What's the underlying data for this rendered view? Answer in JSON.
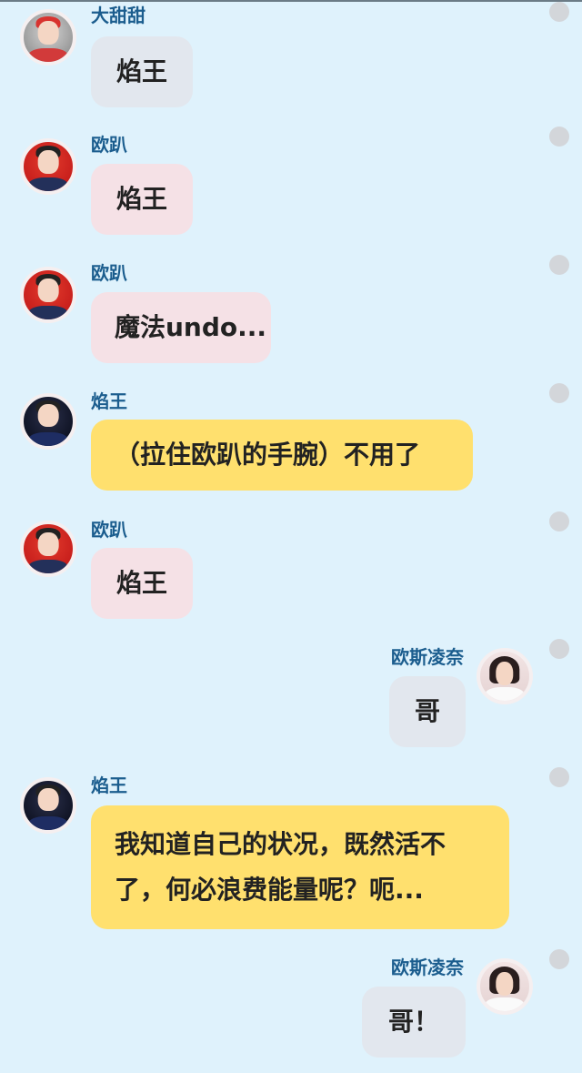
{
  "messages": [
    {
      "side": "left",
      "sender": "大甜甜",
      "text": "焰王",
      "bubble_color": "grey",
      "avatar": "avatar-girl-red-scarf"
    },
    {
      "side": "left",
      "sender": "欧趴",
      "text": "焰王",
      "bubble_color": "pink",
      "avatar": "avatar-boy-red-bg"
    },
    {
      "side": "left",
      "sender": "欧趴",
      "text": "魔法undo...",
      "bubble_color": "pink",
      "avatar": "avatar-boy-red-bg"
    },
    {
      "side": "left",
      "sender": "焰王",
      "text": "（拉住欧趴的手腕）不用了",
      "bubble_color": "yellow",
      "avatar": "avatar-man-dark-stage"
    },
    {
      "side": "left",
      "sender": "欧趴",
      "text": "焰王",
      "bubble_color": "pink",
      "avatar": "avatar-boy-red-bg"
    },
    {
      "side": "right",
      "sender": "欧斯凌奈",
      "text": "哥",
      "bubble_color": "grey",
      "avatar": "avatar-girl-long-hair"
    },
    {
      "side": "left",
      "sender": "焰王",
      "text_line1": "我知道自己的状况，既然活不",
      "text_line2": "了，何必浪费能量呢？呃...",
      "bubble_color": "yellow",
      "avatar": "avatar-man-dark-stage"
    },
    {
      "side": "right",
      "sender": "欧斯凌奈",
      "text": "哥！",
      "bubble_color": "grey",
      "avatar": "avatar-girl-long-hair"
    }
  ],
  "colors": {
    "background": "#dff2fc",
    "name": "#1b5d8e",
    "bubble_grey": "#e2e7ee",
    "bubble_pink": "#f5e1e6",
    "bubble_yellow": "#ffe06e"
  }
}
